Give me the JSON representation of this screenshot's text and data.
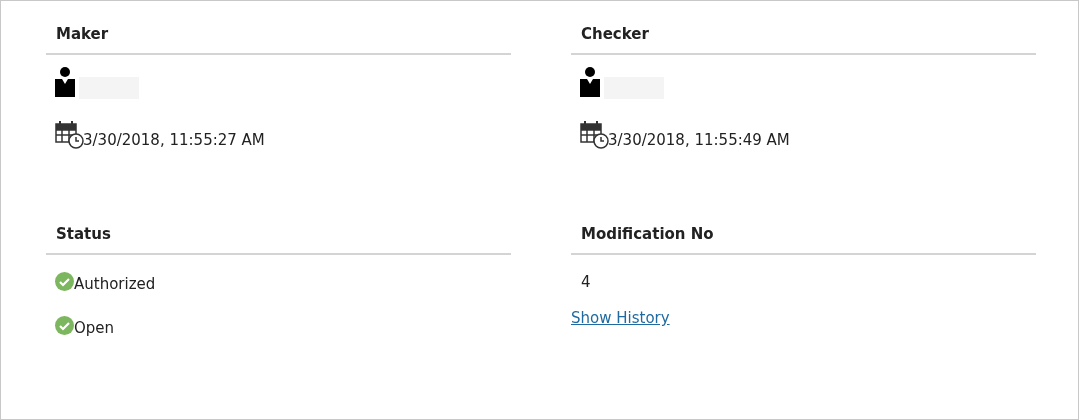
{
  "sections": [
    {
      "heading": "Maker",
      "kind": "audit",
      "timestamp": "3/30/2018, 11:55:27 AM"
    },
    {
      "heading": "Checker",
      "kind": "audit",
      "timestamp": "3/30/2018, 11:55:49 AM"
    },
    {
      "heading": "Status",
      "kind": "status",
      "items": [
        "Authorized",
        "Open"
      ]
    },
    {
      "heading": "Modification No",
      "kind": "modification",
      "value": "4",
      "link": "Show History"
    }
  ]
}
